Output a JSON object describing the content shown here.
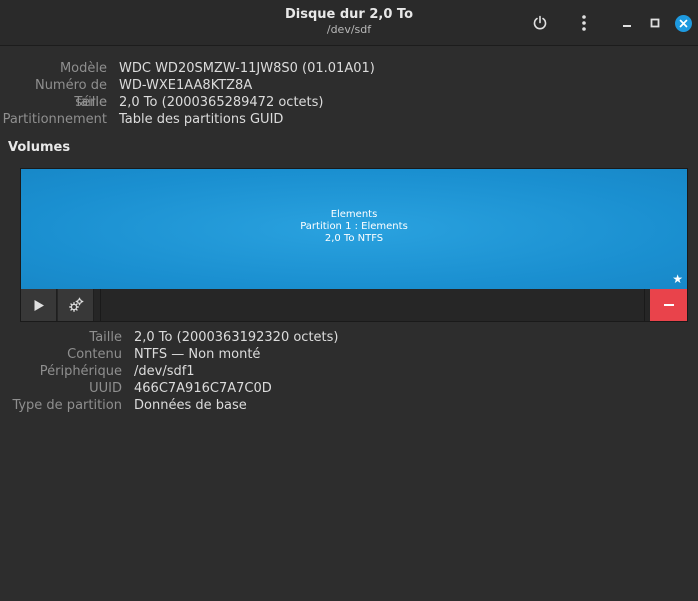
{
  "header": {
    "title": "Disque dur 2,0 To",
    "subtitle": "/dev/sdf",
    "icons": {
      "power": "power-icon",
      "menu": "kebab-menu-icon",
      "minimize": "minimize-icon",
      "maximize": "maximize-icon",
      "close": "close-icon"
    }
  },
  "drive": {
    "model_label": "Modèle",
    "model_value": "WDC WD20SMZW-11JW8S0 (01.01A01)",
    "serial_label": "Numéro de série",
    "serial_value": "WD-WXE1AA8KTZ8A",
    "size_label": "Taille",
    "size_value": "2,0 To (2000365289472 octets)",
    "partitioning_label": "Partitionnement",
    "partitioning_value": "Table des partitions GUID"
  },
  "volumes": {
    "title": "Volumes",
    "partition": {
      "line1": "Elements",
      "line2": "Partition 1 : Elements",
      "line3": "2,0 To NTFS",
      "color": "#1e96d6"
    },
    "toolbar_icons": {
      "play": "play-icon",
      "gear": "gears-icon",
      "remove": "minus-icon",
      "star": "star-icon"
    },
    "remove_color": "#e9434b"
  },
  "partition_details": {
    "size_label": "Taille",
    "size_value": "2,0 To (2000363192320 octets)",
    "content_label": "Contenu",
    "content_value": "NTFS — Non monté",
    "device_label": "Périphérique",
    "device_value": "/dev/sdf1",
    "uuid_label": "UUID",
    "uuid_value": "466C7A916C7A7C0D",
    "type_label": "Type de partition",
    "type_value": "Données de base"
  }
}
